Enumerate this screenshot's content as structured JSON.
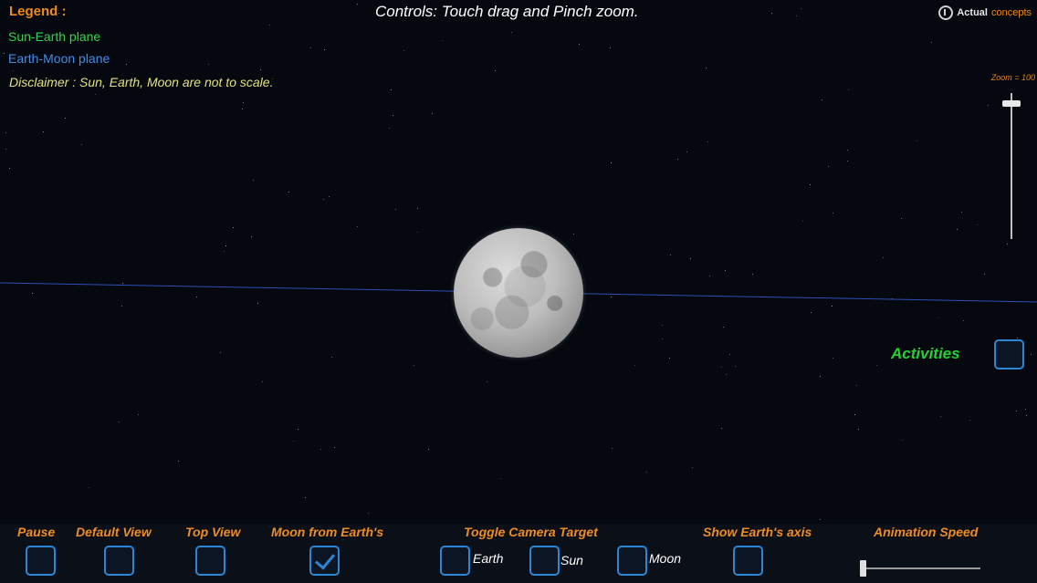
{
  "legend": {
    "title": "Legend :",
    "sun_earth_plane": "Sun-Earth plane",
    "earth_moon_plane": "Earth-Moon plane",
    "disclaimer": "Disclaimer : Sun, Earth, Moon are not  to  scale."
  },
  "header": {
    "controls_text": "Controls: Touch drag and Pinch zoom."
  },
  "brand": {
    "name_part1": "Actual",
    "name_part2": "concepts"
  },
  "zoom": {
    "label": "Zoom = 100",
    "value": 100
  },
  "activities": {
    "label": "Activities",
    "checked": false
  },
  "bottom_bar": {
    "pause_label": "Pause",
    "default_view_label": "Default View",
    "top_view_label": "Top View",
    "moon_from_earth_label": "Moon from Earth's",
    "moon_from_earth_checked": true,
    "toggle_camera_label": "Toggle Camera Target",
    "camera_earth": "Earth",
    "camera_sun": "Sun",
    "camera_moon": "Moon",
    "show_axis_label": "Show Earth's axis",
    "animation_speed_label": "Animation Speed",
    "animation_speed_value": 0
  },
  "colors": {
    "sun_earth_plane": "#33d24a",
    "earth_moon_plane": "#3f8ee8",
    "label_orange": "#ef8c22",
    "checkbox_blue": "#2b87d6",
    "activities_green": "#22d42e"
  },
  "icons": {
    "brand_logo": "actual-concepts-logo-icon",
    "check": "checkmark-icon"
  }
}
